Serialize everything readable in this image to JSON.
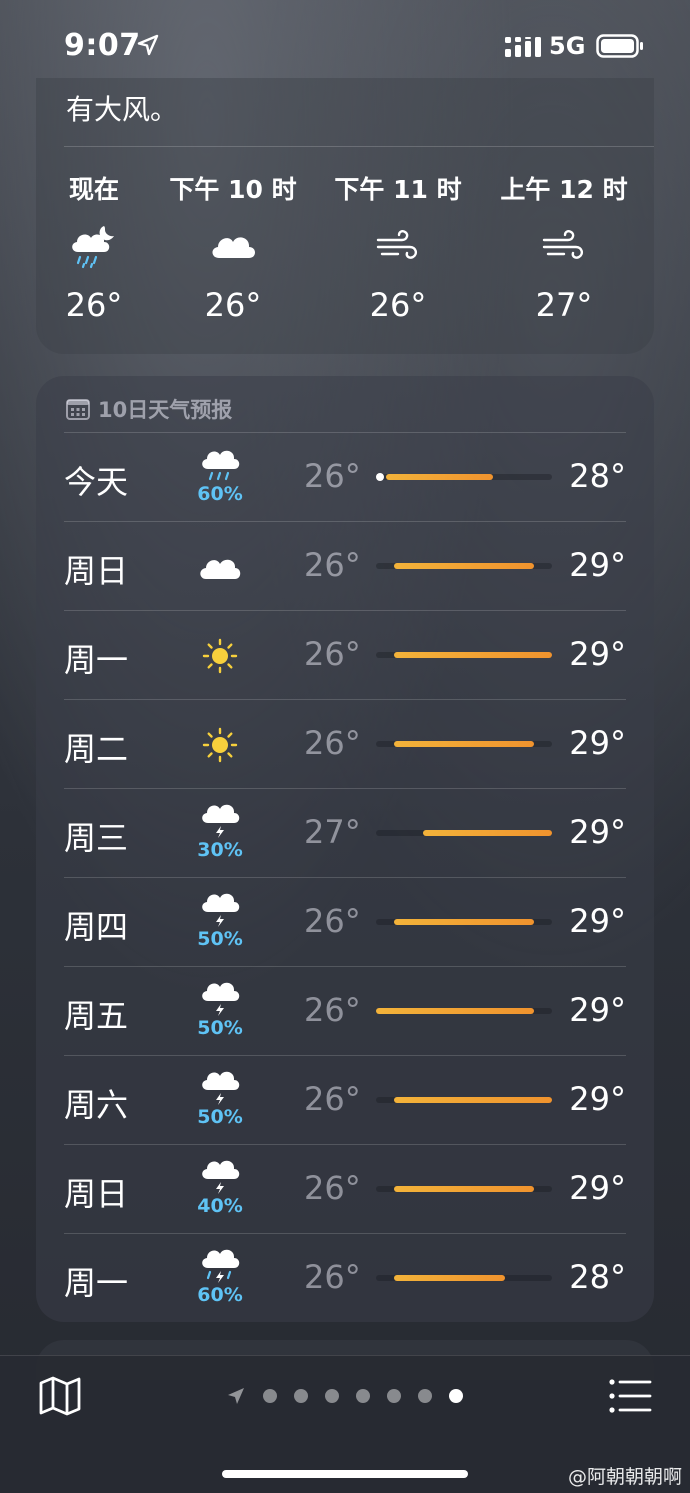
{
  "status_bar": {
    "time": "9:07",
    "network": "5G",
    "icons": [
      "location-arrow-icon",
      "cellular-signal-icon",
      "battery-icon"
    ]
  },
  "hourly": {
    "summary_partial": "有大风。",
    "hours": [
      {
        "label": "现在",
        "icon": "partly-cloudy-night-rain-icon",
        "temp": "26°"
      },
      {
        "label": "下午 10 时",
        "icon": "cloud-icon",
        "temp": "26°"
      },
      {
        "label": "下午 11 时",
        "icon": "wind-icon",
        "temp": "26°"
      },
      {
        "label": "上午 12 时",
        "icon": "wind-icon",
        "temp": "27°"
      }
    ]
  },
  "daily": {
    "header": "10日天气预报",
    "header_icon": "calendar-icon",
    "range_min": 26,
    "range_max": 29,
    "days": [
      {
        "day": "今天",
        "icon": "cloud-rain-icon",
        "pct": "60%",
        "low": "26°",
        "high": "28°",
        "low_v": 26,
        "high_v": 28,
        "now_v": 26
      },
      {
        "day": "周日",
        "icon": "cloud-icon",
        "pct": "",
        "low": "26°",
        "high": "29°",
        "low_v": 26.3,
        "high_v": 28.7
      },
      {
        "day": "周一",
        "icon": "sun-icon",
        "pct": "",
        "low": "26°",
        "high": "29°",
        "low_v": 26.3,
        "high_v": 29
      },
      {
        "day": "周二",
        "icon": "sun-icon",
        "pct": "",
        "low": "26°",
        "high": "29°",
        "low_v": 26.3,
        "high_v": 28.7
      },
      {
        "day": "周三",
        "icon": "cloud-bolt-icon",
        "pct": "30%",
        "low": "27°",
        "high": "29°",
        "low_v": 26.8,
        "high_v": 29
      },
      {
        "day": "周四",
        "icon": "cloud-bolt-icon",
        "pct": "50%",
        "low": "26°",
        "high": "29°",
        "low_v": 26.3,
        "high_v": 28.7
      },
      {
        "day": "周五",
        "icon": "cloud-bolt-icon",
        "pct": "50%",
        "low": "26°",
        "high": "29°",
        "low_v": 26,
        "high_v": 28.7
      },
      {
        "day": "周六",
        "icon": "cloud-bolt-icon",
        "pct": "50%",
        "low": "26°",
        "high": "29°",
        "low_v": 26.3,
        "high_v": 29
      },
      {
        "day": "周日",
        "icon": "cloud-bolt-icon",
        "pct": "40%",
        "low": "26°",
        "high": "29°",
        "low_v": 26.3,
        "high_v": 28.7
      },
      {
        "day": "周一",
        "icon": "cloud-bolt-rain-icon",
        "pct": "60%",
        "low": "26°",
        "high": "28°",
        "low_v": 26.3,
        "high_v": 28.2
      }
    ]
  },
  "bottom_bar": {
    "icons": [
      "map-icon",
      "location-arrow-icon",
      "list-icon"
    ],
    "page_count": 7,
    "active_page": 6
  },
  "watermark": "@阿朝朝朝啊",
  "colors": {
    "temp_bar": "#f0932e",
    "precip": "#5fc3f5"
  }
}
